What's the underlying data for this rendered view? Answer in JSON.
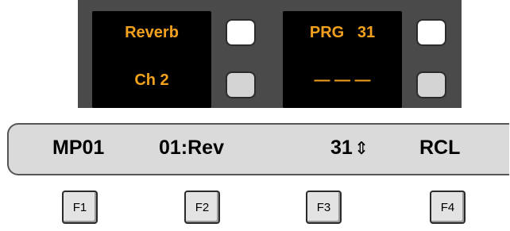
{
  "hardware_panel": {
    "left_display": {
      "line1": "Reverb",
      "line2": "Ch 2"
    },
    "right_display": {
      "line1": "PRG   31",
      "line2": "— — —"
    },
    "text_color": "#f2a11e"
  },
  "lcd": {
    "field1": "MP01",
    "field2": "01:Rev",
    "field3": "31",
    "field3_icon": "up-down-arrow-icon",
    "field3_arrow": "⇕",
    "field4": "RCL"
  },
  "function_keys": [
    "F1",
    "F2",
    "F3",
    "F4"
  ]
}
